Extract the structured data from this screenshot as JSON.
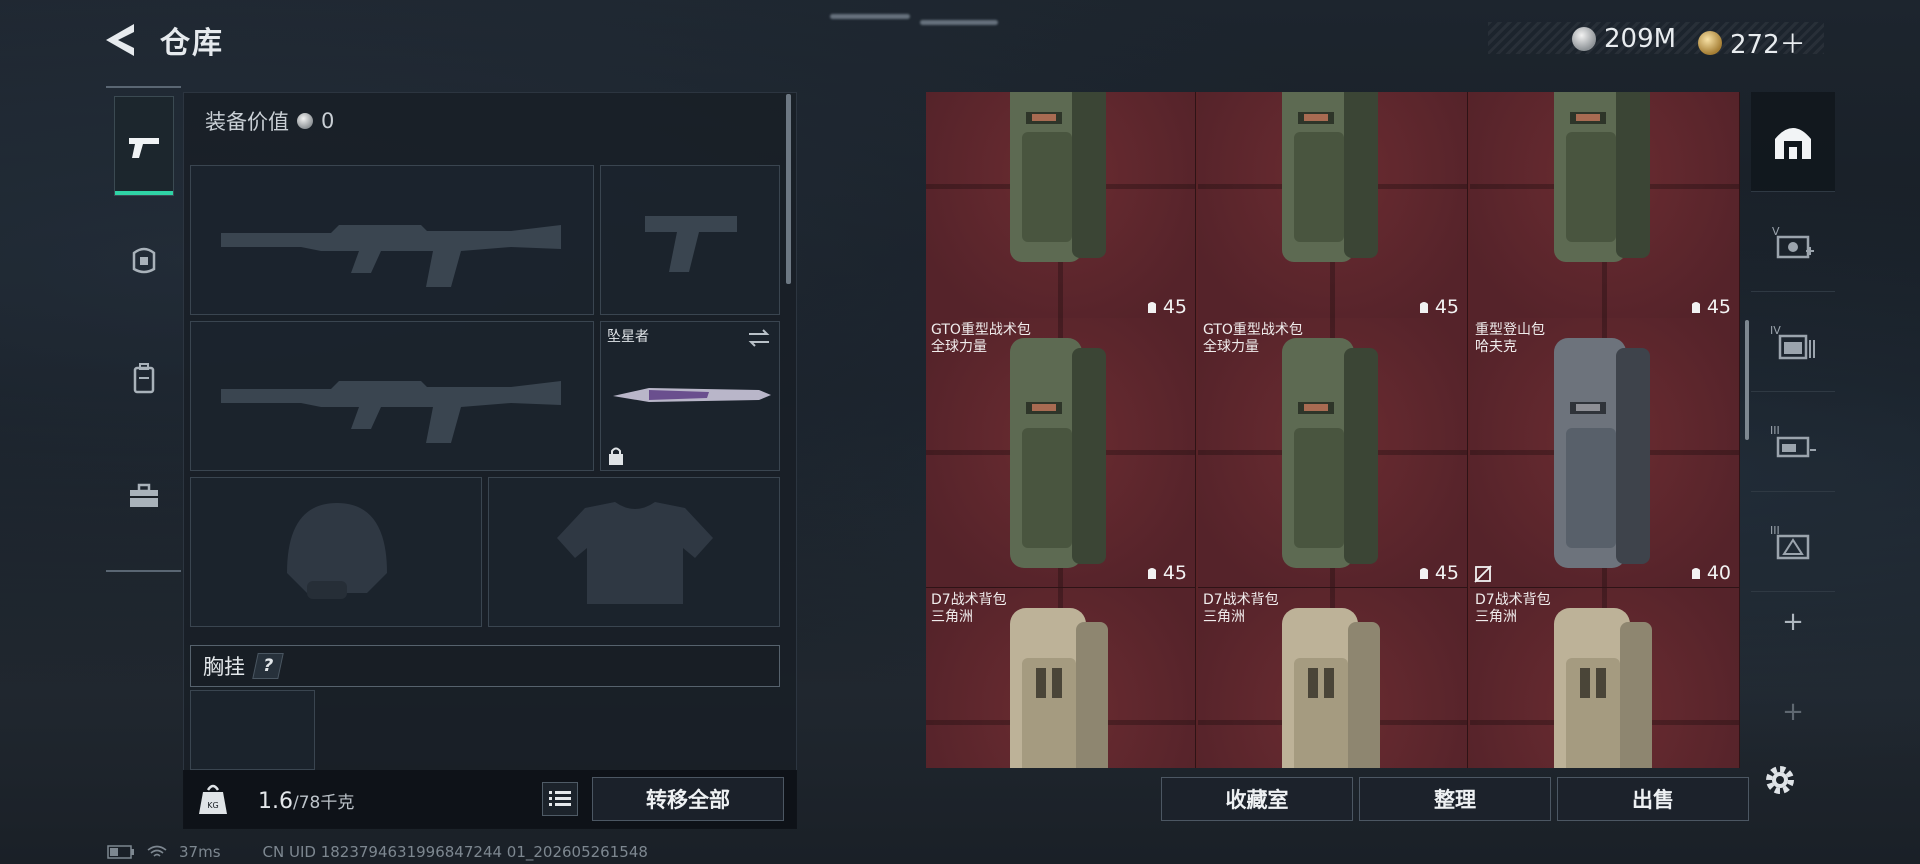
{
  "header": {
    "title": "仓库",
    "currency_silver": "209M",
    "currency_gold": "272＋"
  },
  "loadout": {
    "equip_value_label": "装备价值",
    "equip_value": "0",
    "melee_name": "坠星者",
    "chest_rig_label": "胸挂",
    "chest_rig_help": "?",
    "weight_current": "1.6",
    "weight_max": "/78千克",
    "transfer_all": "转移全部"
  },
  "status": {
    "ping": "37ms",
    "uid": "CN UID 1823794631996847244 01_202605261548"
  },
  "storage": {
    "items": [
      {
        "name": "",
        "brand": "",
        "capacity": "45",
        "color": "green"
      },
      {
        "name": "",
        "brand": "",
        "capacity": "45",
        "color": "green"
      },
      {
        "name": "",
        "brand": "",
        "capacity": "45",
        "color": "green"
      },
      {
        "name": "GTO重型战术包",
        "brand": "全球力量",
        "capacity": "45",
        "color": "green"
      },
      {
        "name": "GTO重型战术包",
        "brand": "全球力量",
        "capacity": "45",
        "color": "green"
      },
      {
        "name": "重型登山包",
        "brand": "哈夫克",
        "capacity": "40",
        "color": "gray"
      },
      {
        "name": "D7战术背包",
        "brand": "三角洲",
        "capacity": "",
        "color": "tan"
      },
      {
        "name": "D7战术背包",
        "brand": "三角洲",
        "capacity": "",
        "color": "tan"
      },
      {
        "name": "D7战术背包",
        "brand": "三角洲",
        "capacity": "",
        "color": "tan"
      }
    ],
    "buttons": {
      "collection": "收藏室",
      "sort": "整理",
      "sell": "出售"
    }
  },
  "right_sidebar": {
    "tabs": [
      "home-vault-icon",
      "tier-v-storage-icon",
      "tier-iv-storage-icon",
      "tier-iii-storage-icon",
      "tier-ii-storage-icon"
    ],
    "plus": "+"
  },
  "colors": {
    "accent": "#2fd3a6",
    "grid_bg": "#5a2327"
  }
}
